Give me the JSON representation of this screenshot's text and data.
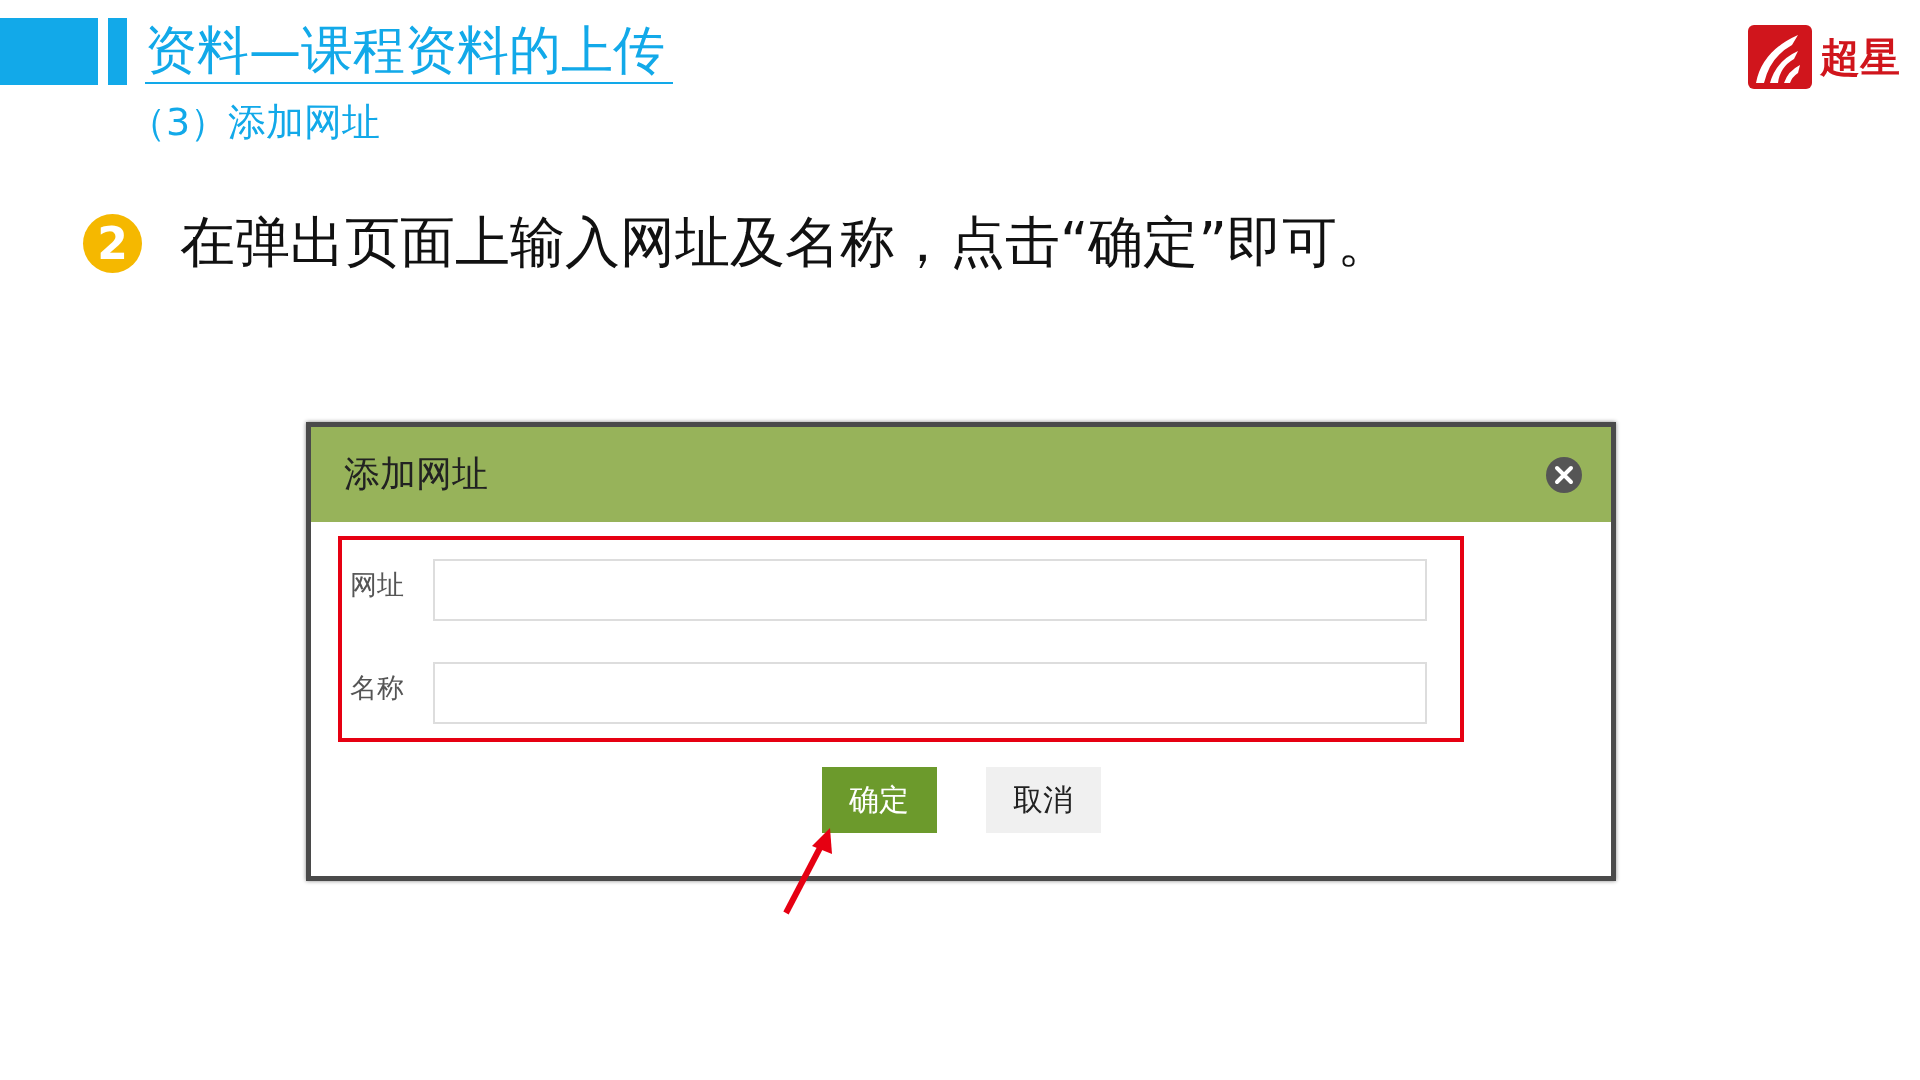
{
  "header": {
    "title": "资料—课程资料的上传",
    "subtitle": "（3）添加网址",
    "logo_text": "超星"
  },
  "step": {
    "number": "2",
    "text": "在弹出页面上输入网址及名称，点击“确定”即可。"
  },
  "dialog": {
    "title": "添加网址",
    "fields": [
      {
        "label": "网址"
      },
      {
        "label": "名称"
      }
    ],
    "buttons": [
      {
        "label": "确定",
        "kind": "primary"
      },
      {
        "label": "取消",
        "kind": "secondary"
      }
    ]
  }
}
